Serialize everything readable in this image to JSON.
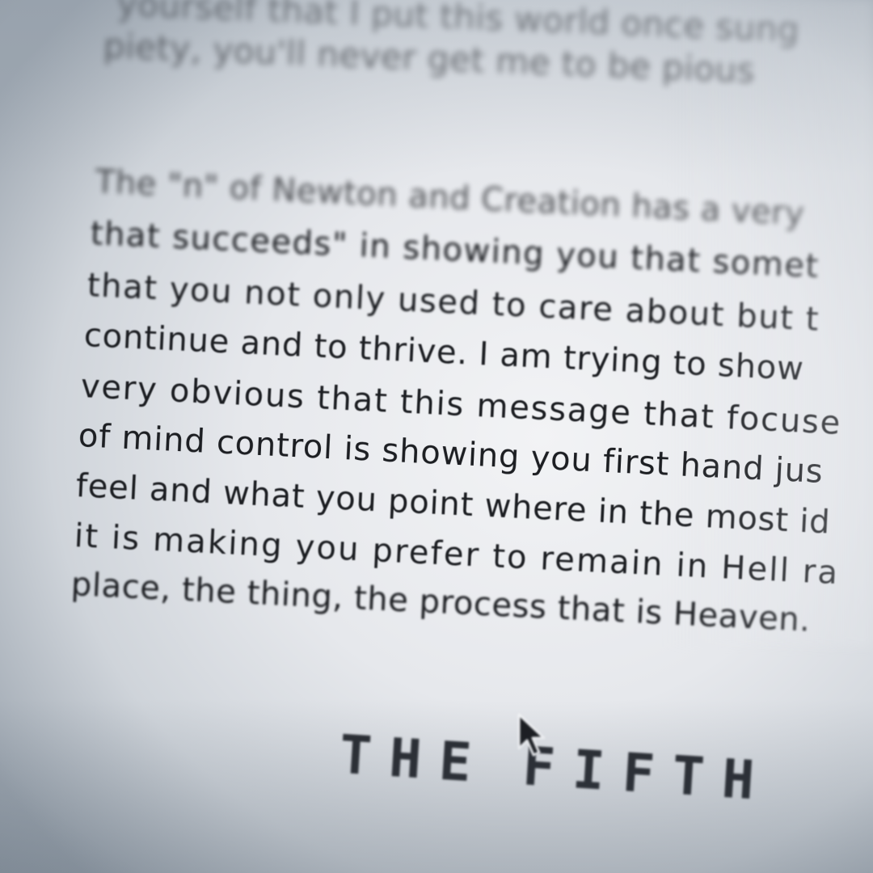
{
  "document": {
    "lines": [
      "yourself that I put this world once sung",
      "piety, you'll never get me to be pious",
      "The \"n\" of Newton and Creation has a very",
      "that succeeds\" in showing you that somet",
      "that you not only used to care about but t",
      "continue and to thrive.  I am trying to show",
      "very obvious that this message that focuse",
      "of mind control is showing you first hand jus",
      "feel and what you point where in the most id",
      "it is making you prefer to remain in Hell ra",
      "place, the thing, the process that is Heaven."
    ],
    "heading": {
      "word1": "THE",
      "word2": "FIFTH"
    }
  },
  "cursor": {
    "icon": "arrow-pointer-icon"
  }
}
